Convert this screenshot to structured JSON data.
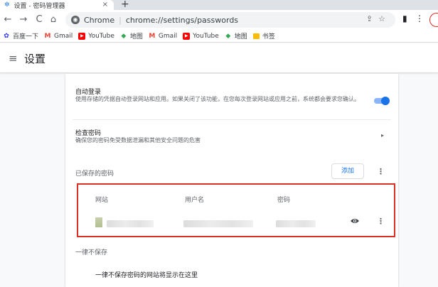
{
  "browser": {
    "tab_title": "设置 - 密码管理器",
    "tab_close": "×",
    "new_tab": "+",
    "nav": {
      "back": "←",
      "forward": "→",
      "reload": "C",
      "home": "⌂"
    },
    "omnibox": {
      "chip": "Chrome",
      "separator": "|",
      "url": "chrome://settings/passwords"
    },
    "bookmarks": [
      {
        "label": "百度一下",
        "icon": "baidu-icon"
      },
      {
        "label": "Gmail",
        "icon": "gmail-icon"
      },
      {
        "label": "YouTube",
        "icon": "youtube-icon"
      },
      {
        "label": "地图",
        "icon": "maps-icon"
      },
      {
        "label": "Gmail",
        "icon": "gmail-icon"
      },
      {
        "label": "YouTube",
        "icon": "youtube-icon"
      },
      {
        "label": "地图",
        "icon": "maps-icon"
      },
      {
        "label": "书签",
        "icon": "folder-icon"
      }
    ]
  },
  "header": {
    "menu_icon": "≡",
    "title": "设置"
  },
  "settings": {
    "auto_signin": {
      "title": "自动登录",
      "description": "使用存储的凭据自动登录网站和应用。如果关闭了该功能，在您每次登录网站或应用之前，系统都会要求您确认。",
      "enabled": true
    },
    "check_passwords": {
      "title": "检查密码",
      "description": "确保您的密码免受数据泄漏和其他安全问题的危害",
      "arrow": "▸"
    },
    "saved_passwords": {
      "label": "已保存的密码",
      "add_label": "添加",
      "more": "⋮",
      "columns": [
        "网站",
        "用户名",
        "密码"
      ],
      "row_more": "⋮"
    },
    "never_saved": {
      "label": "一律不保存",
      "empty_message": "一律不保存密码的网站将显示在这里"
    }
  },
  "colors": {
    "accent": "#1a73e8",
    "highlight_box": "#d93025"
  }
}
